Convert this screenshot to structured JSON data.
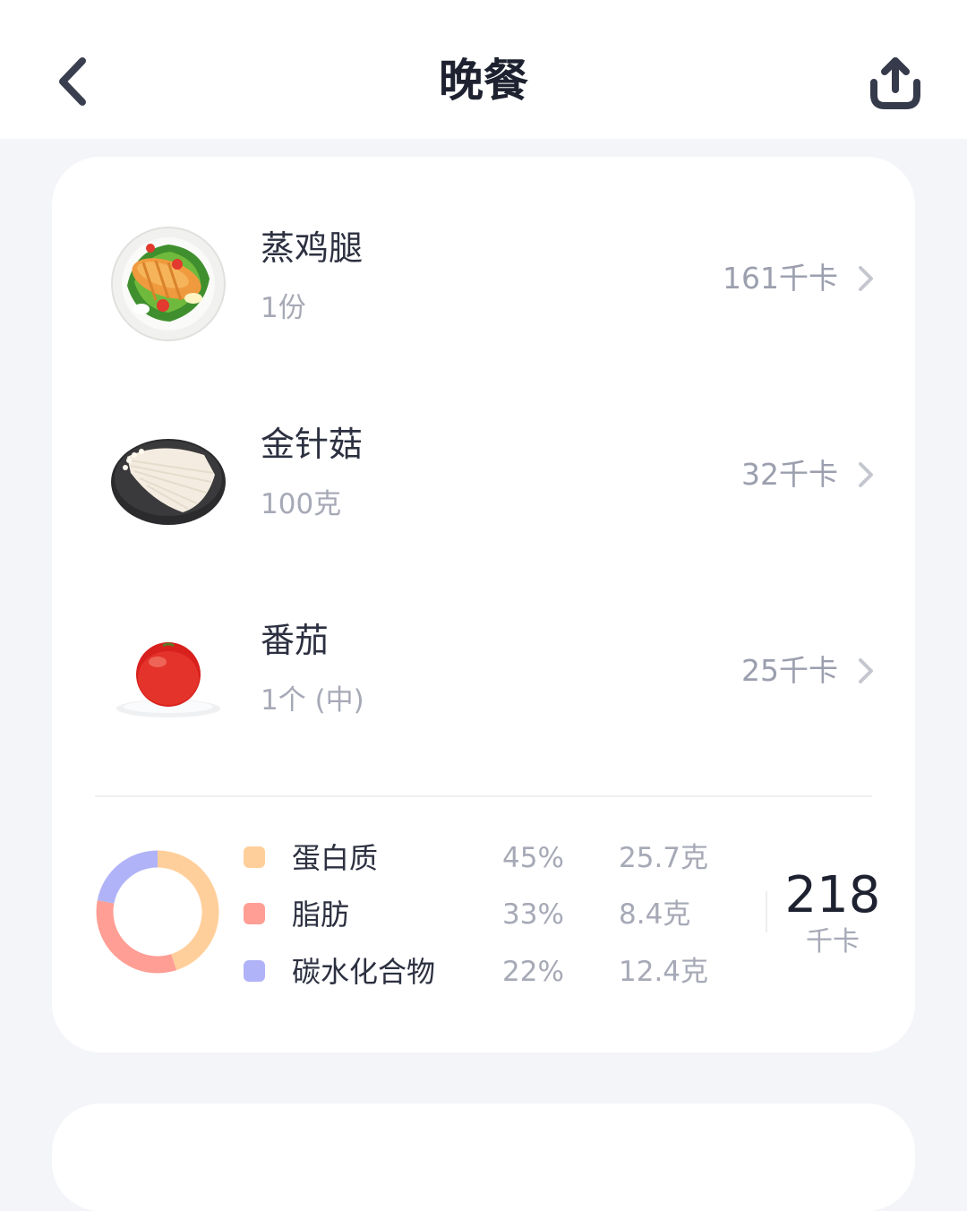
{
  "header": {
    "title": "晚餐"
  },
  "foods": [
    {
      "name": "蒸鸡腿",
      "portion": "1份",
      "kcal": "161千卡",
      "icon": "steamed-chicken-leg-image"
    },
    {
      "name": "金针菇",
      "portion": "100克",
      "kcal": "32千卡",
      "icon": "enoki-mushroom-image"
    },
    {
      "name": "番茄",
      "portion": "1个 (中)",
      "kcal": "25千卡",
      "icon": "tomato-image"
    }
  ],
  "nutrition": {
    "items": [
      {
        "name": "蛋白质",
        "pct": "45%",
        "amount": "25.7克",
        "color": "#ffcf9b",
        "share": 0.45
      },
      {
        "name": "脂肪",
        "pct": "33%",
        "amount": "8.4克",
        "color": "#ff9e94",
        "share": 0.33
      },
      {
        "name": "碳水化合物",
        "pct": "22%",
        "amount": "12.4克",
        "color": "#b0b3f7",
        "share": 0.22
      }
    ],
    "total_value": "218",
    "total_unit": "千卡"
  },
  "colors": {
    "background": "#f4f5f9",
    "card": "#ffffff",
    "title": "#1e2230",
    "muted": "#a6a9b6"
  }
}
